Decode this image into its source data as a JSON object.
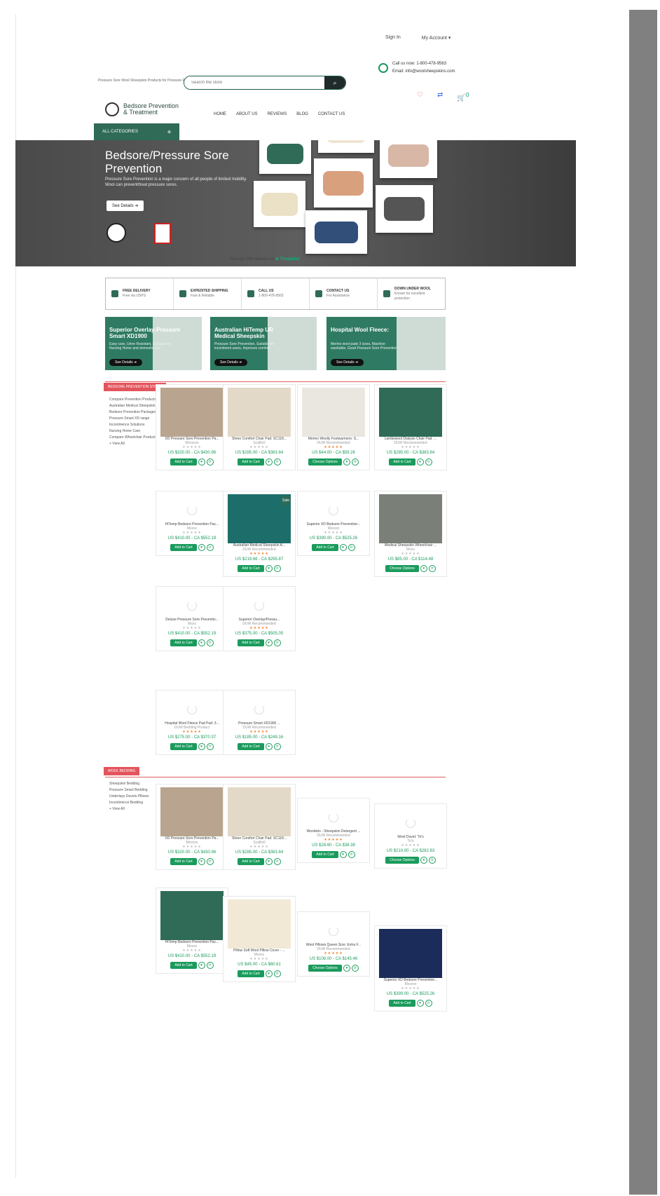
{
  "header": {
    "tagline": "Pressure Sore Wool Sheepskin Products for Pressure Relief",
    "sign_in": "Sign In",
    "my_account": "My Account ▾",
    "call": "Call us now: 1-800-478-9563",
    "email": "Email: info@woolsheepskins.com",
    "search_placeholder": "Search the store",
    "cart_count": "0",
    "logo_line1": "Bedsore Prevention",
    "logo_line2": "& Treatment",
    "nav": [
      "HOME",
      "ABOUT US",
      "REVIEWS",
      "BLOG",
      "CONTACT US"
    ],
    "all_categories": "ALL CATEGORIES"
  },
  "hero": {
    "title": "Bedsore/Pressure Sore Prevention",
    "desc": "Pressure Sore Prevention is a major concern of all people of limited mobility. Wool can prevent/treat pressure sores.",
    "btn": "See Details"
  },
  "trustpilot": {
    "text": "See our 106 reviews on",
    "brand": "★ Trustpilot"
  },
  "features": [
    {
      "title": "FREE DELIVERY",
      "sub": "Free via USPS"
    },
    {
      "title": "EXPEDITED SHIPPING",
      "sub": "Fast & Reliable"
    },
    {
      "title": "CALL US",
      "sub": "1-800-478-9563"
    },
    {
      "title": "CONTACT US",
      "sub": "For Assistance"
    },
    {
      "title": "DOWN UNDER WOOL",
      "sub": "Known for excellent protection"
    }
  ],
  "banners": [
    {
      "title": "Superior Overlay-Pressure Smart XD1900",
      "desc": "Easy care, Urine Resistant, Suitable for Nursing Home and domestic use",
      "btn": "See Details"
    },
    {
      "title": "Australian HiTemp UR Medical Sheepskin",
      "desc": "Pressure Sore Prevention, Suitable for incontinent users, Improves comfort",
      "btn": "See Details"
    },
    {
      "title": "Hospital Wool Fleece:",
      "desc": "Merino wool pads 3 sizes, Machine washable, Good Pressure Sore Prevention",
      "btn": "See Details"
    }
  ],
  "section1": {
    "header": "BEDSORE PREVENTION STORE",
    "links": [
      "Compare Prevention Products",
      "Australian Medical Sheepskin Absorbs",
      "Bedsore Prevention Packages",
      "Pressure Smart XD range",
      "Incontinence Solutions",
      "Nursing Home Care",
      "Compare Wheelchair Products",
      "+ View All"
    ]
  },
  "section2": {
    "header": "WOOL BEDDING",
    "links": [
      "Sheepskin Bedding",
      "Pressure Smart Bedding",
      "Underlays Duvets Pillows",
      "Incontinence Bedding",
      "+ View All"
    ]
  },
  "products": [
    {
      "name": "XD Pressure Sore Prevention Pa...",
      "brand": "Mxxxxxx",
      "stars": "★★★★★",
      "price": "US $320.00 - CA $430.96",
      "btn": "Add to Cart",
      "img": "#b9a58f"
    },
    {
      "name": "Sheer Comfort Chair Pad: SC118...",
      "brand": "ScaBx0",
      "stars": "★★★★★",
      "price": "US $285.00 - CA $383.84",
      "btn": "Add to Cart",
      "img": "#e3d9c8"
    },
    {
      "name": "Merino Woolly Footwarmers: S...",
      "brand": "DUW Recommended",
      "stars": "★★★★★",
      "price": "US $44.00 - CA $59.26",
      "btn": "Choose Options",
      "img": "#eae7e0",
      "orange": true
    },
    {
      "name": "Lambswool Dialysis Chair Pad: ...",
      "brand": "DUW Recommended",
      "stars": "★★★★★",
      "price": "US $285.00 - CA $383.84",
      "btn": "Add to Cart",
      "img": "#2f6b57"
    },
    {
      "name": "HiTemp Bedsore Prevention Pac...",
      "brand": "Mxxxx",
      "stars": "★★★★★",
      "price": "US $410.00 - CA $552.19",
      "btn": "Add to Cart"
    },
    {
      "name": "Australian Medical Sheepskin A...",
      "brand": "DUW Recommended",
      "stars": "★★★★★",
      "price": "US $219.68 - CA $295.87",
      "btn": "Add to Cart",
      "img": "#1d6e6a",
      "orange": true,
      "sale": "Sale"
    },
    {
      "name": "Superior XD Bedsore Prevention...",
      "brand": "Mxxxxx",
      "stars": "★★★★★",
      "price": "US $390.00 - CA $525.26",
      "btn": "Add to Cart"
    },
    {
      "name": "Medical Sheepskin Wheelchair ...",
      "brand": "Mxxx",
      "stars": "★★★★★",
      "price": "US $85.00 - CA $114.48",
      "btn": "Choose Options",
      "img": "#7a7f78"
    },
    {
      "name": "Deluxe Pressure Sore Preventio...",
      "brand": "Mxxx",
      "stars": "★★★★★",
      "price": "US $410.00 - CA $552.19",
      "btn": "Add to Cart"
    },
    {
      "name": "Superior Overlay/Pressu...",
      "brand": "DUW Recommended",
      "stars": "★★★★★",
      "price": "US $375.00 - CA $505.05",
      "btn": "Add to Cart",
      "orange": true
    },
    {
      "name": "Hospital Wool Fleece Pad Pad: 3...",
      "brand": "DUW Bedding Product",
      "stars": "★★★★★",
      "price": "US $275.00 - CA $370.37",
      "btn": "Add to Cart",
      "orange": true
    },
    {
      "name": "Pressure Smart XD1900 ...",
      "brand": "DUW Recommended",
      "stars": "★★★★★",
      "price": "US $185.00 - CA $249.16",
      "btn": "Add to Cart",
      "orange": true
    },
    {
      "name": "XD Pressure Sore Prevention Pa...",
      "brand": "Mxxxxx",
      "stars": "★★★★★",
      "price": "US $320.00 - CA $430.96",
      "btn": "Add to Cart",
      "img": "#b9a58f"
    },
    {
      "name": "Sheer Comfort Chair Pad: SC118...",
      "brand": "ScaBx0",
      "stars": "★★★★★",
      "price": "US $285.00 - CA $383.84",
      "btn": "Add to Cart",
      "img": "#e3d9c8"
    },
    {
      "name": "Woolskin - Sheepskin Detergent ...",
      "brand": "DUW Recommended",
      "stars": "★★★★★",
      "price": "US $28.60 - CA $38.38",
      "btn": "Add to Cart",
      "orange": true
    },
    {
      "name": "Wool Duvet: Tri's",
      "brand": "Tri's",
      "stars": "★★★★★",
      "price": "US $210.00 - CA $282.83",
      "btn": "Choose Options"
    },
    {
      "name": "HiTemp Bedsore Prevention Pac...",
      "brand": "Mxxxx",
      "stars": "★★★★★",
      "price": "US $410.00 - CA $552.19",
      "btn": "Add to Cart",
      "img": "#2f6b57"
    },
    {
      "name": "Pillow Soft Wool Pillow Cover - ...",
      "brand": "Mxxxx",
      "stars": "★★★★★",
      "price": "US $45.00 - CA $60.61",
      "btn": "Add to Cart",
      "img": "#f1e9d6"
    },
    {
      "name": "Wool Pillows Queen Size: Extra F...",
      "brand": "DUW Recommended",
      "stars": "★★★★★",
      "price": "US $108.00 - CA $145.46",
      "btn": "Choose Options",
      "orange": true
    },
    {
      "name": "Superior XD Bedsore Prevention...",
      "brand": "Mxxxxx",
      "stars": "★★★★★",
      "price": "US $390.00 - CA $525.26",
      "btn": "Add to Cart",
      "img": "#1c2c5a"
    }
  ],
  "colors": {
    "brand_green": "#2f6b57",
    "accent_green": "#1a9b5c",
    "sale_red": "#e4545c"
  }
}
